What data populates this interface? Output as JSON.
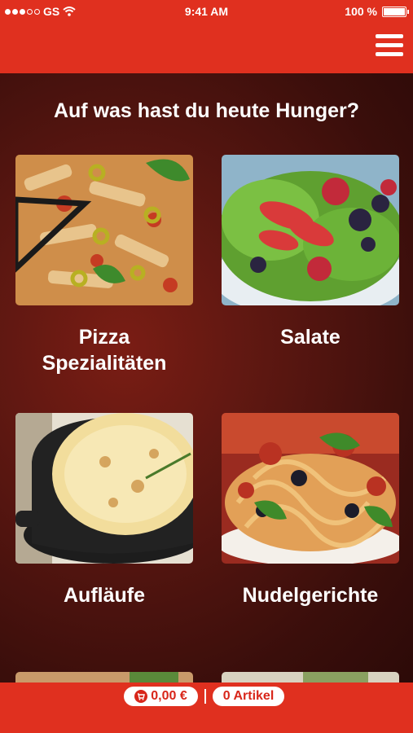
{
  "status_bar": {
    "carrier": "GS",
    "time": "9:41 AM",
    "battery": "100 %",
    "battery_level": 1.0
  },
  "navbar": {
    "menu_icon": "hamburger-menu-icon"
  },
  "main": {
    "heading": "Auf was hast du heute Hunger?",
    "categories": [
      {
        "label_line1": "Pizza",
        "label_line2": "Spezialitäten"
      },
      {
        "label_line1": "Salate"
      },
      {
        "label_line1": "Aufläufe"
      },
      {
        "label_line1": "Nudelgerichte"
      }
    ]
  },
  "cart": {
    "icon": "cart-icon",
    "total": "0,00 €",
    "separator": "|",
    "items": "0 Artikel"
  },
  "colors": {
    "brand_red": "#e0301f",
    "background_dark": "#3a0f0c"
  }
}
